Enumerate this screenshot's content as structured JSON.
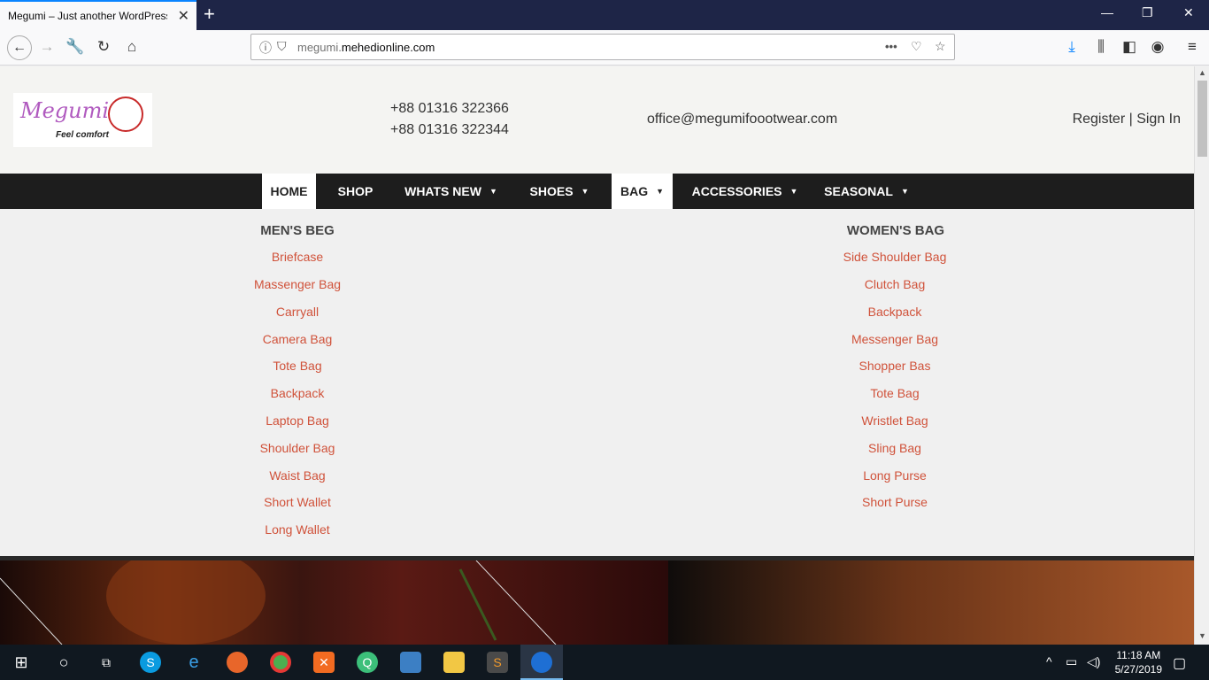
{
  "browser": {
    "tab_title": "Megumi – Just another WordPress site",
    "tab_close": "✕",
    "new_tab": "+",
    "url_prefix": "megumi.",
    "url_domain": "mehedionline.com",
    "url_more": "•••"
  },
  "header": {
    "logo_text": "Megumi",
    "logo_sub": "Feel comfort",
    "phone1": "+88 01316 322366",
    "phone2": "+88 01316 322344",
    "email": "office@megumifoootwear.com",
    "auth": "Register | Sign In"
  },
  "menu": {
    "home": "HOME",
    "shop": "SHOP",
    "whats_new": "WHATS NEW",
    "shoes": "SHOES",
    "bag": "BAG",
    "accessories": "ACCESSORIES",
    "seasonal": "SEASONAL"
  },
  "mega": {
    "men_title": "MEN'S BEG",
    "men_links": [
      "Briefcase",
      "Massenger Bag",
      "Carryall",
      "Camera Bag",
      "Tote Bag",
      "Backpack",
      "Laptop Bag",
      "Shoulder Bag",
      "Waist Bag",
      "Short Wallet",
      "Long Wallet"
    ],
    "women_title": "WOMEN'S BAG",
    "women_links": [
      "Side Shoulder Bag",
      "Clutch Bag",
      "Backpack",
      "Messenger Bag",
      "Shopper Bas",
      "Tote Bag",
      "Wristlet Bag",
      "Sling Bag",
      "Long Purse",
      "Short Purse"
    ]
  },
  "taskbar": {
    "time": "11:18 AM",
    "date": "5/27/2019"
  },
  "colors": {
    "accent_link": "#d0523a",
    "menu_bg": "#1d1d1d",
    "browser_accent": "#0a84ff"
  }
}
